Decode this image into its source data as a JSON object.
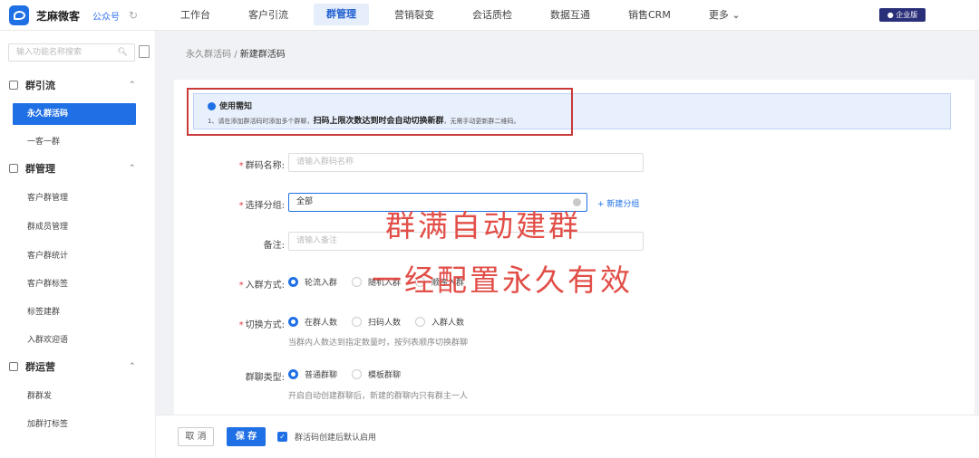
{
  "brand": {
    "name": "芝麻微客",
    "sub": "公众号",
    "edition": "企业版"
  },
  "nav": [
    "工作台",
    "客户引流",
    "群管理",
    "营销裂变",
    "会话质检",
    "数据互通",
    "销售CRM",
    "更多 ⌄"
  ],
  "sidebar": {
    "search_placeholder": "输入功能名称搜索",
    "groups": [
      {
        "label": "群引流",
        "items": [
          "永久群活码",
          "一客一群"
        ]
      },
      {
        "label": "群管理",
        "items": [
          "客户群管理",
          "群成员管理",
          "客户群统计",
          "客户群标签",
          "标签建群",
          "入群欢迎语"
        ]
      },
      {
        "label": "群运营",
        "items": [
          "群群发",
          "加群打标签"
        ]
      }
    ]
  },
  "breadcrumb": {
    "parent": "永久群活码",
    "sep": "/",
    "current": "新建群活码"
  },
  "notice": {
    "title": "使用需知",
    "line_pre": "1、请在添加群活码时添加多个群聊，",
    "line_bold": "扫码上限次数达到时会自动切换新群",
    "line_post": "，无需手动更新群二维码。"
  },
  "form": {
    "name_label": "群码名称:",
    "name_placeholder": "请输入群码名称",
    "group_label": "选择分组:",
    "group_value": "全部",
    "new_group": "+ 新建分组",
    "remark_label": "备注:",
    "remark_placeholder": "请输入备注",
    "join_label": "入群方式:",
    "join_opts": [
      "轮流入群",
      "随机入群",
      "顺序入群"
    ],
    "switch_label": "切换方式:",
    "switch_opts": [
      "在群人数",
      "扫码人数",
      "入群人数"
    ],
    "switch_hint": "当群内人数达到指定数量时，按列表顺序切换群聊",
    "type_label": "群聊类型:",
    "type_opts": [
      "普通群聊",
      "模板群聊"
    ],
    "type_hint": "开启自动创建群聊后，新建的群聊内只有群主一人"
  },
  "overlay": {
    "line1": "群满自动建群",
    "line2": "一经配置永久有效"
  },
  "footer": {
    "cancel": "取 消",
    "save": "保 存",
    "enable_label": "群活码创建后默认启用"
  }
}
